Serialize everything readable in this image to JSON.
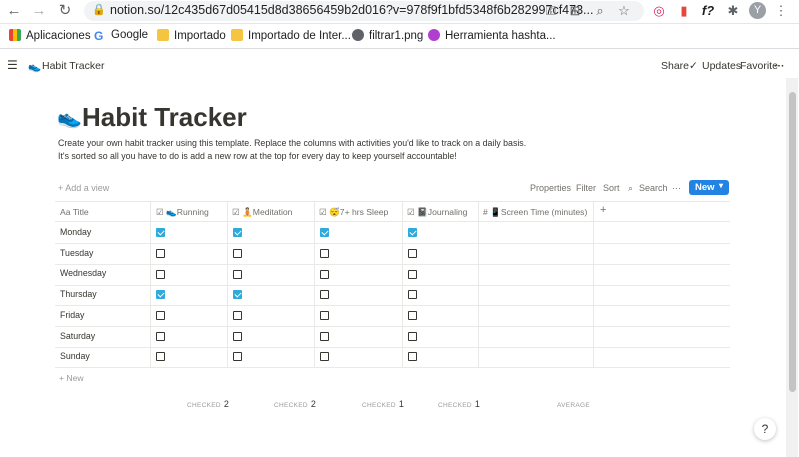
{
  "browser": {
    "url": "notion.so/12c435d67d05415d8d38656459b2d016?v=978f9f1bfd5348f6b282997cf473...",
    "profile_initial": "Y"
  },
  "bookmarks": {
    "apps": "Aplicaciones",
    "items": [
      "Google",
      "Importado",
      "Importado de Inter...",
      "filtrar1.png",
      "Herramienta hashta..."
    ]
  },
  "notion_topbar": {
    "breadcrumb": "Habit Tracker",
    "share": "Share",
    "updates": "Updates",
    "favorite": "Favorite"
  },
  "page": {
    "title": "Habit Tracker",
    "description": "Create your own habit tracker using this template. Replace the columns with activities you'd like to track on a daily basis. It's sorted so all you have to do is add a new row at the top for every day to keep yourself accountable!"
  },
  "db_toolbar": {
    "add_view": "+ Add a view",
    "properties": "Properties",
    "filter": "Filter",
    "sort": "Sort",
    "search": "Search",
    "more": "···",
    "new": "New"
  },
  "table": {
    "headers": [
      "Aa Title",
      "☑ 👟Running",
      "☑ 🧘Meditation",
      "☑ 😴7+ hrs Sleep",
      "☑ 📓Journaling",
      "# 📱Screen Time (minutes)",
      "+"
    ],
    "rows": [
      {
        "title": "Monday",
        "checks": [
          true,
          true,
          true,
          true
        ]
      },
      {
        "title": "Tuesday",
        "checks": [
          false,
          false,
          false,
          false
        ]
      },
      {
        "title": "Wednesday",
        "checks": [
          false,
          false,
          false,
          false
        ]
      },
      {
        "title": "Thursday",
        "checks": [
          true,
          true,
          false,
          false
        ]
      },
      {
        "title": "Friday",
        "checks": [
          false,
          false,
          false,
          false
        ]
      },
      {
        "title": "Saturday",
        "checks": [
          false,
          false,
          false,
          false
        ]
      },
      {
        "title": "Sunday",
        "checks": [
          false,
          false,
          false,
          false
        ]
      }
    ],
    "new_row": "+ New",
    "calcs": [
      {
        "label": "CHECKED",
        "value": "2"
      },
      {
        "label": "CHECKED",
        "value": "2"
      },
      {
        "label": "CHECKED",
        "value": "1"
      },
      {
        "label": "CHECKED",
        "value": "1"
      },
      {
        "label": "AVERAGE",
        "value": ""
      }
    ]
  },
  "help": "?"
}
